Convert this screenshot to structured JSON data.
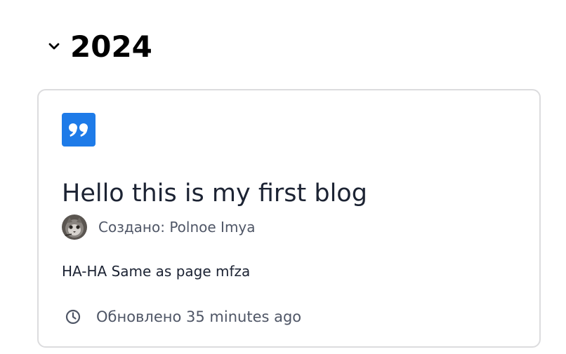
{
  "section": {
    "year": "2024",
    "toggle_icon": "chevron-down-icon"
  },
  "post": {
    "type_icon": "quote-icon",
    "type_icon_color": "#1e7be8",
    "title": "Hello this is my first blog",
    "author_label": "Создано: Polnoe Imya",
    "summary": "HA-HA Same as page mfza",
    "updated_icon": "clock-icon",
    "updated_label": "Обновлено 35 minutes ago"
  },
  "colors": {
    "heading": "#000000",
    "text": "#1c2333",
    "muted": "#4f5666",
    "border": "#dcdcde"
  }
}
